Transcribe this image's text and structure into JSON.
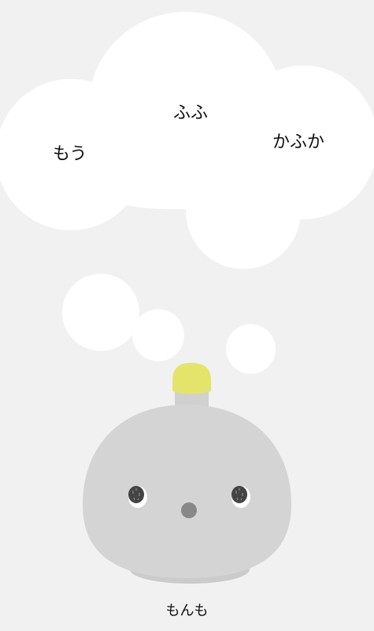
{
  "thought": {
    "words": [
      "もう",
      "ふふ",
      "かふか"
    ]
  },
  "character": {
    "name": "もんも",
    "body_color": "#d4d4d4",
    "light_color": "#e4e46a",
    "eye_color": "#444444",
    "nose_color": "#888888"
  }
}
